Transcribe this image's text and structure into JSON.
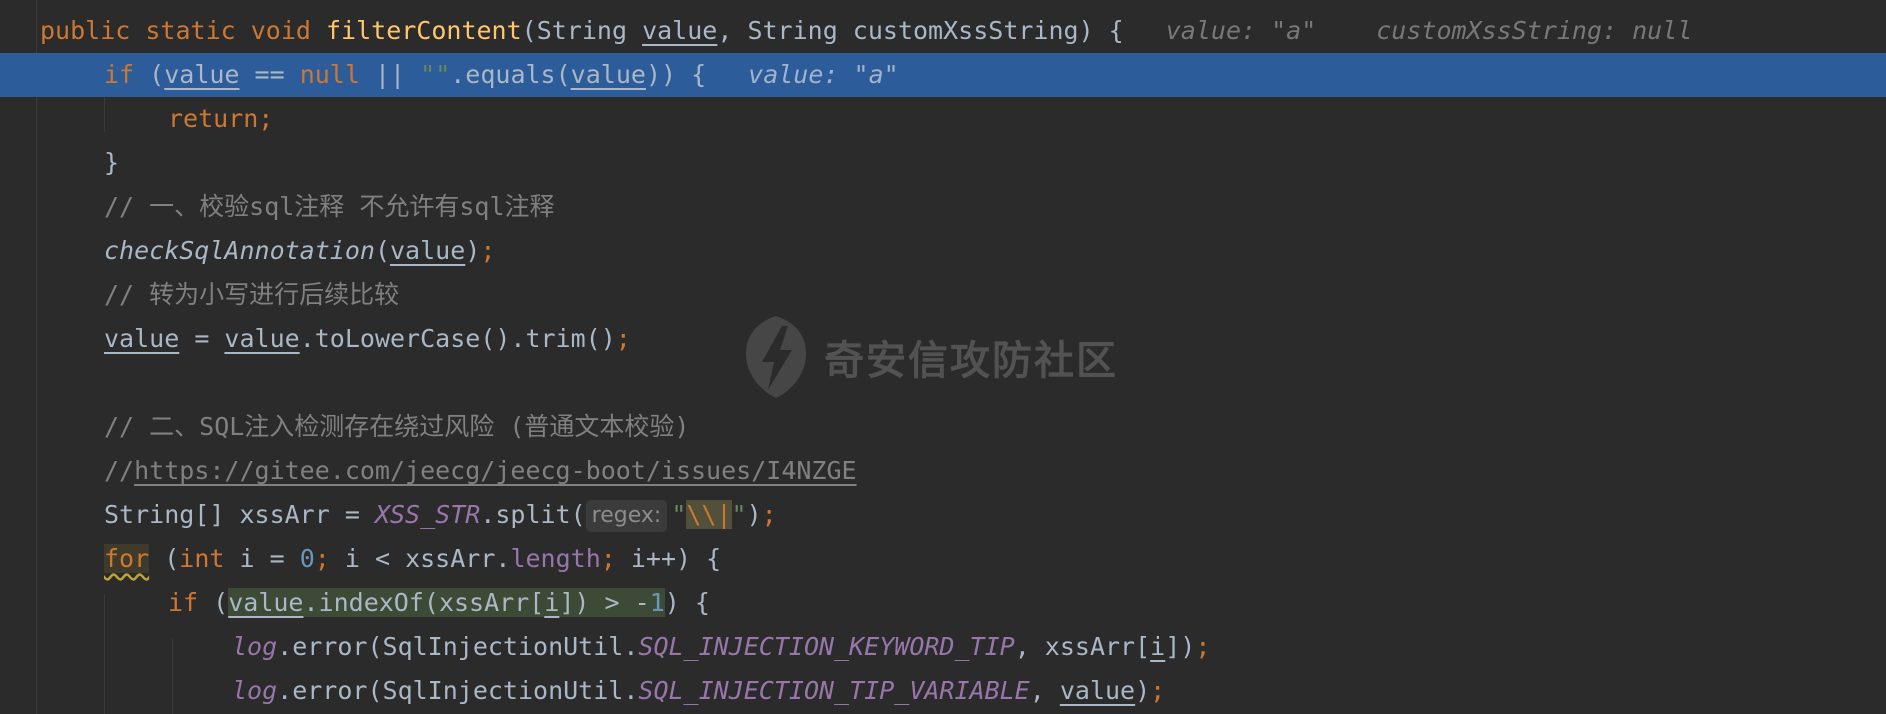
{
  "code": {
    "l1": {
      "kw1": "public static void ",
      "fn": "filterContent",
      "p1": "(String ",
      "arg1": "value",
      "p2": ", String customXssString) {",
      "inlay1": "value: \"a\"",
      "inlay2": "customXssString: null"
    },
    "l2": {
      "kw_if": "if",
      "t1": " (",
      "arg": "value",
      "t2": " == ",
      "kw_null": "null",
      "t3": " || ",
      "str": "\"\"",
      "t4": ".equals(",
      "arg2": "value",
      "t5": ")) {",
      "inlay": "value: \"a\""
    },
    "l3": {
      "kw": "return;"
    },
    "l4": {
      "t": "}"
    },
    "l5": {
      "comment": "// 一、校验sql注释 不允许有sql注释"
    },
    "l6": {
      "fn": "checkSqlAnnotation",
      "t1": "(",
      "arg": "value",
      "t2": ")",
      "semi": ";"
    },
    "l7": {
      "comment": "// 转为小写进行后续比较"
    },
    "l8": {
      "arg1": "value",
      "t1": " = ",
      "arg2": "value",
      "t2": ".toLowerCase().trim()",
      "semi": ";"
    },
    "l10": {
      "comment": "// 二、SQL注入检测存在绕过风险 (普通文本校验)"
    },
    "l11": {
      "prefix": "//",
      "url": "https://gitee.com/jeecg/jeecg-boot/issues/I4NZGE"
    },
    "l12": {
      "t1": "String[] xssArr = ",
      "const": "XSS_STR",
      "t2": ".split(",
      "hint": "regex:",
      "q1": "\"",
      "esc": "\\\\|",
      "q2": "\"",
      "t3": ")",
      "semi": ";"
    },
    "l13": {
      "kw_for": "for",
      "t1": " (",
      "kw_int": "int",
      "t2": " i = ",
      "num": "0",
      "semi1": ";",
      "t3": " i < xssArr.",
      "fld": "length",
      "semi2": ";",
      "t4": " i++) {"
    },
    "l14": {
      "kw_if": "if",
      "t1": " (",
      "arg": "value",
      "t2": ".indexOf(xssArr[",
      "idx": "i",
      "t3": "]) > -",
      "num": "1",
      "t4": ") {"
    },
    "l15": {
      "log": "log",
      "t1": ".error(SqlInjectionUtil.",
      "const": "SQL_INJECTION_KEYWORD_TIP",
      "t2": ", xssArr[",
      "idx": "i",
      "t3": "])",
      "semi": ";"
    },
    "l16": {
      "log": "log",
      "t1": ".error(SqlInjectionUtil.",
      "const": "SQL_INJECTION_TIP_VARIABLE",
      "t2": ", ",
      "arg": "value",
      "t3": ")",
      "semi": ";"
    }
  },
  "watermark": {
    "text": "奇安信攻防社区",
    "icon": "lightning-shield-icon"
  },
  "colors": {
    "background": "#2b2b2b",
    "current_line": "#2d5c9b",
    "keyword": "#cc7832",
    "function": "#ffc66d",
    "string": "#6a8759",
    "number": "#6897bb",
    "comment": "#808080",
    "static_field": "#9876aa",
    "default_text": "#a9b7c6"
  }
}
